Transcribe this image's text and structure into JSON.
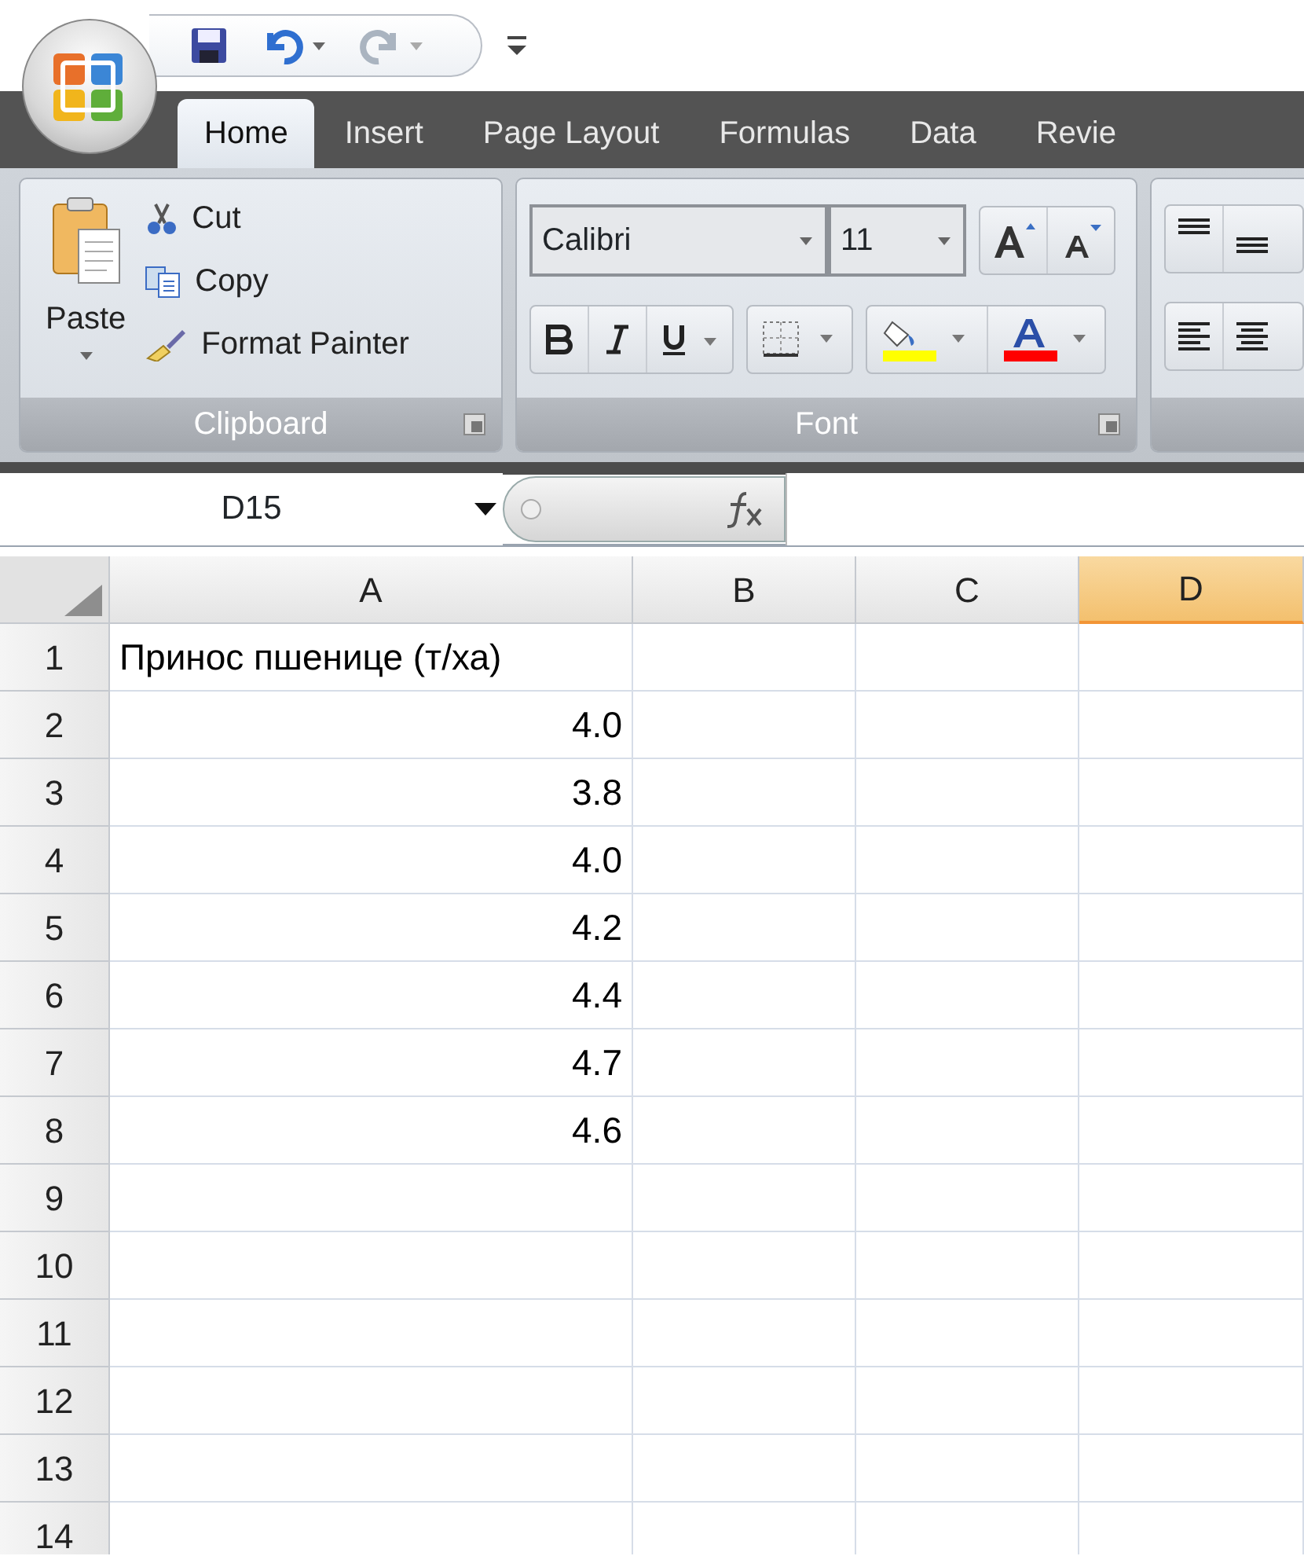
{
  "tabs": [
    {
      "label": "Home",
      "selected": true
    },
    {
      "label": "Insert",
      "selected": false
    },
    {
      "label": "Page Layout",
      "selected": false
    },
    {
      "label": "Formulas",
      "selected": false
    },
    {
      "label": "Data",
      "selected": false
    },
    {
      "label": "Revie",
      "selected": false
    }
  ],
  "ribbon": {
    "groups": [
      {
        "kind": "clipboard",
        "label": "Clipboard",
        "paste": "Paste",
        "items": [
          "Cut",
          "Copy",
          "Format Painter"
        ]
      },
      {
        "kind": "font",
        "label": "Font",
        "font_name": "Calibri",
        "font_size": "11"
      },
      {
        "kind": "alignment"
      }
    ]
  },
  "formula_bar": {
    "name_box": "D15"
  },
  "sheet": {
    "columns": [
      {
        "label": "A",
        "selected": false
      },
      {
        "label": "B",
        "selected": false
      },
      {
        "label": "C",
        "selected": false
      },
      {
        "label": "D",
        "selected": true
      }
    ],
    "rows": [
      {
        "header": "1",
        "value": "Принос пшенице (т/ха)",
        "kind": "text"
      },
      {
        "header": "2",
        "value": "4.0",
        "kind": "number"
      },
      {
        "header": "3",
        "value": "3.8",
        "kind": "number"
      },
      {
        "header": "4",
        "value": "4.0",
        "kind": "number"
      },
      {
        "header": "5",
        "value": "4.2",
        "kind": "number"
      },
      {
        "header": "6",
        "value": "4.4",
        "kind": "number"
      },
      {
        "header": "7",
        "value": "4.7",
        "kind": "number"
      },
      {
        "header": "8",
        "value": "4.6",
        "kind": "number"
      },
      {
        "header": "9"
      },
      {
        "header": "10"
      },
      {
        "header": "11"
      },
      {
        "header": "12"
      },
      {
        "header": "13"
      },
      {
        "header": "14"
      }
    ]
  }
}
